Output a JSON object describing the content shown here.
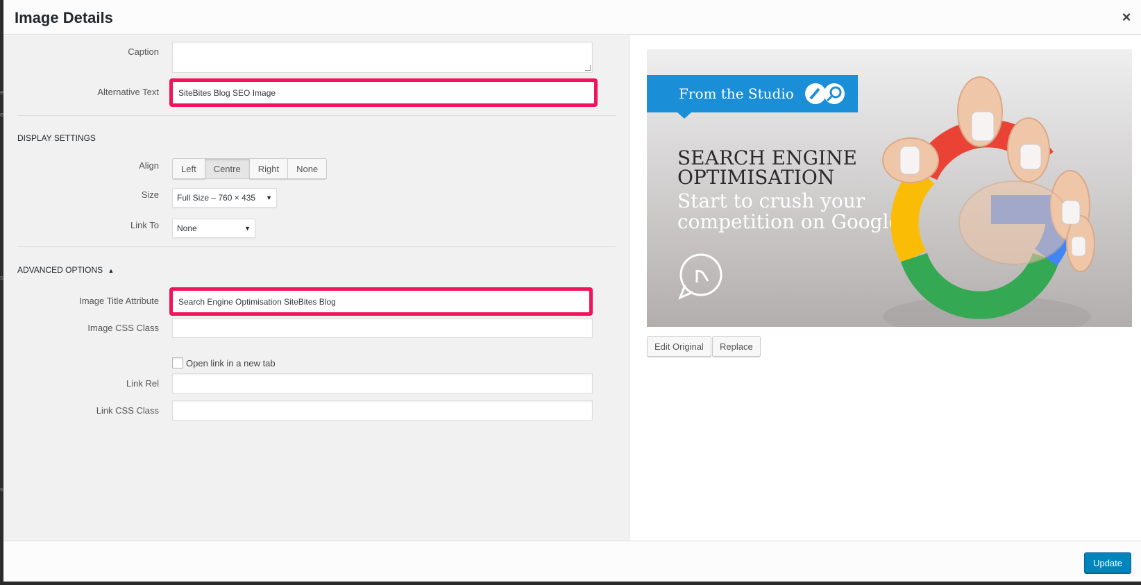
{
  "modal": {
    "title": "Image Details",
    "close_glyph": "×"
  },
  "fields": {
    "caption_label": "Caption",
    "caption_value": "",
    "alt_label": "Alternative Text",
    "alt_value": "SiteBites Blog SEO Image"
  },
  "display_settings": {
    "heading": "DISPLAY SETTINGS",
    "align_label": "Align",
    "align_options": [
      "Left",
      "Centre",
      "Right",
      "None"
    ],
    "align_selected": "Centre",
    "size_label": "Size",
    "size_value": "Full Size – 760 × 435",
    "link_to_label": "Link To",
    "link_to_value": "None"
  },
  "advanced": {
    "heading": "ADVANCED OPTIONS",
    "toggle_glyph": "▲",
    "title_attr_label": "Image Title Attribute",
    "title_attr_value": "Search Engine Optimisation SiteBites Blog",
    "css_class_label": "Image CSS Class",
    "css_class_value": "",
    "new_tab_label": "Open link in a new tab",
    "new_tab_checked": false,
    "link_rel_label": "Link Rel",
    "link_rel_value": "",
    "link_css_label": "Link CSS Class",
    "link_css_value": ""
  },
  "preview": {
    "banner_text": "From the Studio",
    "headline_1": "SEARCH ENGINE",
    "headline_2": "OPTIMISATION",
    "sub_1": "Start to crush your",
    "sub_2": "competition on Google",
    "edit_original_label": "Edit Original",
    "replace_label": "Replace"
  },
  "footer": {
    "update_label": "Update"
  },
  "colors": {
    "highlight": "#f0145a",
    "primary": "#0085ba",
    "banner_blue": "#1a8ed6",
    "google_red": "#ea4335",
    "google_yellow": "#fbbc05",
    "google_green": "#34a853",
    "google_blue": "#4285f4"
  }
}
